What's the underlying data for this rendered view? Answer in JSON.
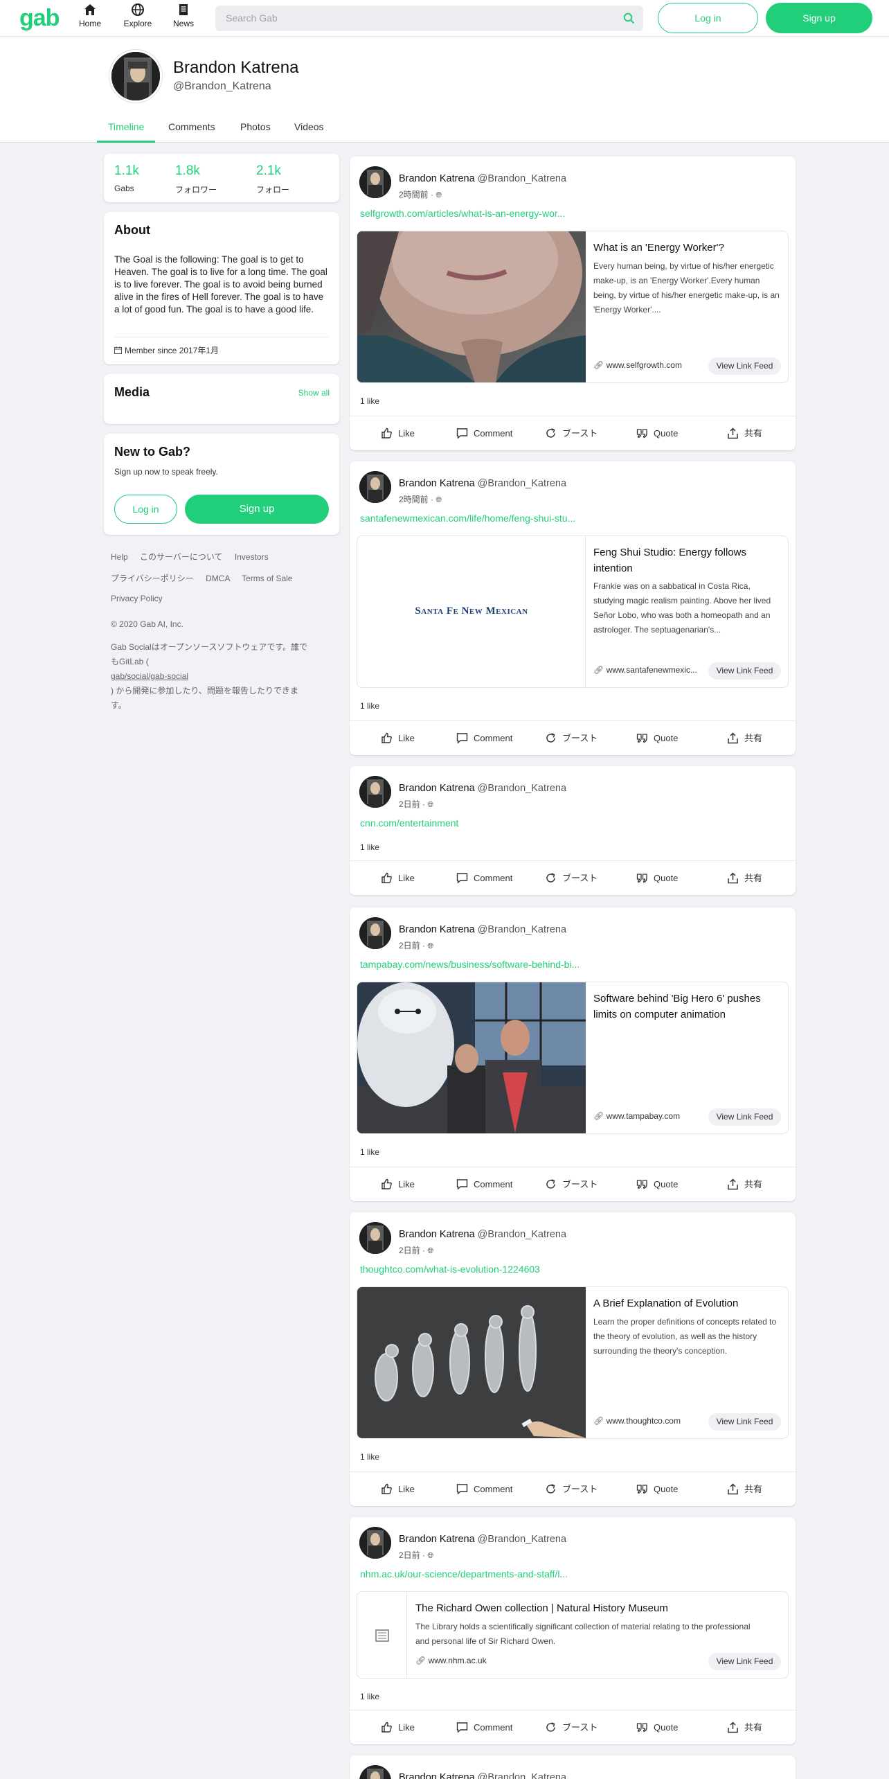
{
  "nav": {
    "logo": "gab",
    "items": [
      {
        "label": "Home",
        "icon": "home-icon"
      },
      {
        "label": "Explore",
        "icon": "globe-icon"
      },
      {
        "label": "News",
        "icon": "news-icon"
      }
    ],
    "search_placeholder": "Search Gab",
    "login_label": "Log in",
    "signup_label": "Sign up"
  },
  "profile": {
    "name": "Brandon Katrena",
    "handle": "@Brandon_Katrena",
    "tabs": [
      "Timeline",
      "Comments",
      "Photos",
      "Videos"
    ],
    "active_tab": "Timeline"
  },
  "stats": [
    {
      "value": "1.1k",
      "label": "Gabs"
    },
    {
      "value": "1.8k",
      "label": "フォロワー"
    },
    {
      "value": "2.1k",
      "label": "フォロー"
    }
  ],
  "about": {
    "title": "About",
    "text": "The Goal is the following: The goal is to get to Heaven. The goal is to live for a long time. The goal is to live forever. The goal is to avoid being burned alive in the fires of Hell forever. The goal is to have a lot of good fun. The goal is to have a good life.",
    "member_since": "Member since 2017年1月"
  },
  "media": {
    "title": "Media",
    "show_all": "Show all"
  },
  "newtogab": {
    "title": "New to Gab?",
    "subtitle": "Sign up now to speak freely.",
    "login_label": "Log in",
    "signup_label": "Sign up"
  },
  "footer": {
    "links_row1": [
      "Help",
      "このサーバーについて",
      "Investors"
    ],
    "links_row2": [
      "プライバシーポリシー",
      "DMCA",
      "Terms of Sale"
    ],
    "links_row3": [
      "Privacy Policy"
    ],
    "copyright": "© 2020 Gab AI, Inc.",
    "oss_line1": "Gab Socialはオープンソースソフトウェアです。誰で",
    "oss_line2": "もGitLab (",
    "oss_link": "gab/social/gab-social",
    "oss_line3": ") から開発に参加したり、問題を報告したりできま",
    "oss_line4": "す。"
  },
  "actions": {
    "like": "Like",
    "comment": "Comment",
    "boost": "ブースト",
    "quote": "Quote",
    "share": "共有"
  },
  "posts": [
    {
      "author": "Brandon Katrena",
      "handle": "@Brandon_Katrena",
      "time": "2時間前 ·",
      "link": "selfgrowth.com/articles/what-is-an-energy-wor...",
      "card": {
        "title": "What is an 'Energy Worker'?",
        "desc": "Every human being, by virtue of his/her energetic make-up, is an 'Energy Worker'.Every human being, by virtue of his/her energetic make-up, is an 'Energy Worker'....",
        "domain": "www.selfgrowth.com",
        "button": "View Link Feed"
      },
      "likes": "1 like"
    },
    {
      "author": "Brandon Katrena",
      "handle": "@Brandon_Katrena",
      "time": "2時間前 ·",
      "link": "santafenewmexican.com/life/home/feng-shui-stu...",
      "card": {
        "title": "Feng Shui Studio: Energy follows intention",
        "desc": "Frankie was on a sabbatical in Costa Rica, studying magic realism painting. Above her lived Señor Lobo, who was both a homeopath and an astrologer. The septuagenarian's...",
        "domain": "www.santafenewmexic...",
        "button": "View Link Feed",
        "logo_text": "Santa Fe New Mexican"
      },
      "likes": "1 like"
    },
    {
      "author": "Brandon Katrena",
      "handle": "@Brandon_Katrena",
      "time": "2日前 ·",
      "link": "cnn.com/entertainment",
      "likes": "1 like"
    },
    {
      "author": "Brandon Katrena",
      "handle": "@Brandon_Katrena",
      "time": "2日前 ·",
      "link": "tampabay.com/news/business/software-behind-bi...",
      "card": {
        "title": "Software behind 'Big Hero 6' pushes limits on computer animation",
        "domain": "www.tampabay.com",
        "button": "View Link Feed"
      },
      "likes": "1 like"
    },
    {
      "author": "Brandon Katrena",
      "handle": "@Brandon_Katrena",
      "time": "2日前 ·",
      "link": "thoughtco.com/what-is-evolution-1224603",
      "card": {
        "title": "A Brief Explanation of Evolution",
        "desc": "Learn the proper definitions of concepts related to the theory of evolution, as well as the history surrounding the theory's conception.",
        "domain": "www.thoughtco.com",
        "button": "View Link Feed"
      },
      "likes": "1 like"
    },
    {
      "author": "Brandon Katrena",
      "handle": "@Brandon_Katrena",
      "time": "2日前 ·",
      "link": "nhm.ac.uk/our-science/departments-and-staff/l...",
      "card": {
        "title": "The Richard Owen collection | Natural History Museum",
        "desc": "The Library holds a scientifically significant collection of material relating to the professional and personal life of Sir Richard Owen.",
        "domain": "www.nhm.ac.uk",
        "button": "View Link Feed"
      },
      "likes": "1 like"
    },
    {
      "author": "Brandon Katrena",
      "handle": "@Brandon_Katrena"
    }
  ],
  "colors": {
    "brand": "#21cf7a",
    "background": "#f0f2f5"
  }
}
